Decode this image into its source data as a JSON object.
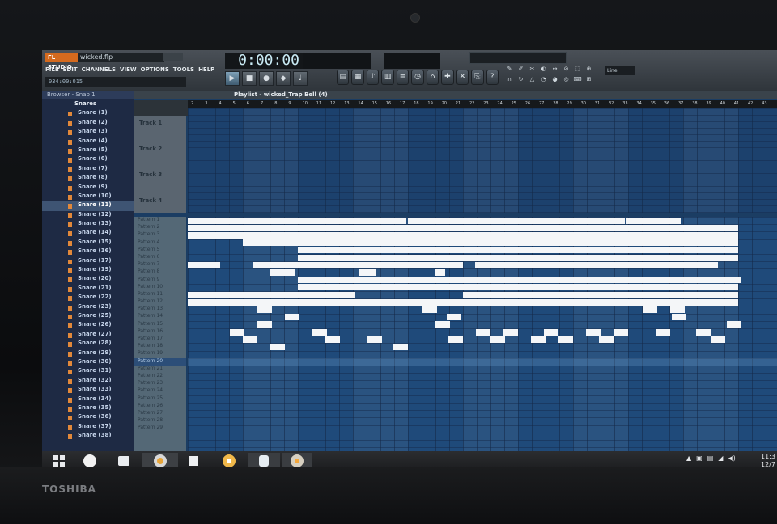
{
  "device": {
    "brand": "TOSHIBA"
  },
  "app": {
    "logo": "FL STUDIO",
    "file_name": "wicked.flp",
    "menu": [
      "FILE",
      "EDIT",
      "CHANNELS",
      "VIEW",
      "OPTIONS",
      "TOOLS",
      "HELP"
    ],
    "song_position": "034:00:015",
    "time_display": "0:00:00",
    "snap_mode": "Line"
  },
  "browser": {
    "title": "Browser - Snap 1",
    "folder": "Snares",
    "items": [
      "Snare (1)",
      "Snare (2)",
      "Snare (3)",
      "Snare (4)",
      "Snare (5)",
      "Snare (6)",
      "Snare (7)",
      "Snare (8)",
      "Snare (9)",
      "Snare (10)",
      "Snare (11)",
      "Snare (12)",
      "Snare (13)",
      "Snare (14)",
      "Snare (15)",
      "Snare (16)",
      "Snare (17)",
      "Snare (19)",
      "Snare (20)",
      "Snare (21)",
      "Snare (22)",
      "Snare (23)",
      "Snare (25)",
      "Snare (26)",
      "Snare (27)",
      "Snare (28)",
      "Snare (29)",
      "Snare (30)",
      "Snare (31)",
      "Snare (32)",
      "Snare (33)",
      "Snare (34)",
      "Snare (35)",
      "Snare (36)",
      "Snare (37)",
      "Snare (38)"
    ],
    "selected_index": 10
  },
  "playlist": {
    "title": "Playlist - wicked_Trap Bell (4)",
    "ruler": [
      "2",
      "3",
      "4",
      "5",
      "6",
      "7",
      "8",
      "9",
      "10",
      "11",
      "12",
      "13",
      "14",
      "15",
      "16",
      "17",
      "18",
      "19",
      "20",
      "21",
      "22",
      "23",
      "24",
      "25",
      "26",
      "27",
      "28",
      "29",
      "30",
      "31",
      "32",
      "33",
      "34",
      "35",
      "36",
      "37",
      "38",
      "39",
      "40",
      "41",
      "42",
      "43"
    ],
    "tracks": [
      "Track 1",
      "Track 2",
      "Track 3",
      "Track 4"
    ],
    "patterns": [
      "Pattern 1",
      "Pattern 2",
      "Pattern 3",
      "Pattern 4",
      "Pattern 5",
      "Pattern 6",
      "Pattern 7",
      "Pattern 8",
      "Pattern 9",
      "Pattern 10",
      "Pattern 11",
      "Pattern 12",
      "Pattern 13",
      "Pattern 14",
      "Pattern 15",
      "Pattern 16",
      "Pattern 17",
      "Pattern 18",
      "Pattern 19",
      "Pattern 20",
      "Pattern 21",
      "Pattern 22",
      "Pattern 23",
      "Pattern 24",
      "Pattern 25",
      "Pattern 26",
      "Pattern 27",
      "Pattern 28",
      "Pattern 29"
    ],
    "selected_pattern_index": 19
  },
  "taskbar": {
    "apps": [
      "start-icon",
      "browser-icon",
      "files-icon",
      "fl-studio-icon",
      "store-icon",
      "media-icon",
      "app-icon",
      "disc-icon"
    ],
    "clock_time": "11:3",
    "clock_date": "12/7"
  },
  "colors": {
    "playlist_bg": "#1f4a7a",
    "pattern_block": "#f4f6f8",
    "browser_bg": "#1e2a44"
  }
}
